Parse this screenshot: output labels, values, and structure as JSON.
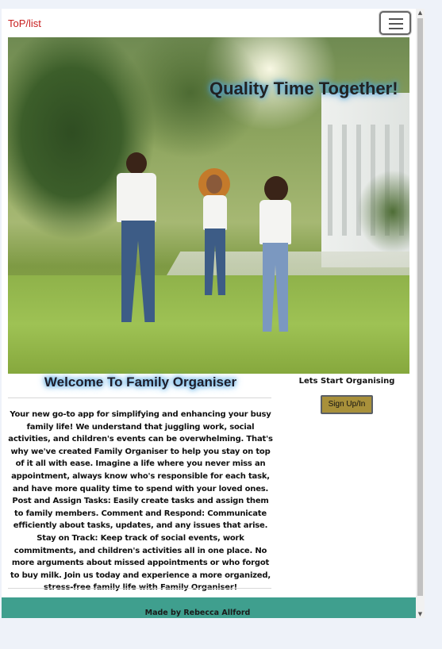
{
  "navbar": {
    "brand": "ToP/list",
    "toggler_icon": "hamburger-icon"
  },
  "hero": {
    "title": "Quality Time Together!",
    "image": "family-in-park-photo"
  },
  "welcome": {
    "heading": "Welcome To Family Organiser",
    "about": "Your new go-to app for simplifying and enhancing your busy family life! We understand that juggling work, social activities, and children's events can be overwhelming. That's why we've created Family Organiser to help you stay on top of it all with ease. Imagine a life where you never miss an appointment, always know who's responsible for each task, and have more quality time to spend with your loved ones. Post and Assign Tasks: Easily create tasks and assign them to family members. Comment and Respond: Communicate efficiently about tasks, updates, and any issues that arise. Stay on Track: Keep track of social events, work commitments, and children's activities all in one place. No more arguments about missed appointments or who forgot to buy milk. Join us today and experience a more organized, stress-free family life with Family Organiser!"
  },
  "sidebar": {
    "start_label": "Lets Start Organising",
    "signup_button": "Sign Up/In"
  },
  "footer": {
    "text": "Made by Rebecca Allford"
  },
  "colors": {
    "brand": "#c81e1e",
    "footer_bg": "#3f9f8e",
    "button_bg": "#a8903a",
    "title_glow": "#4aa3e0"
  }
}
